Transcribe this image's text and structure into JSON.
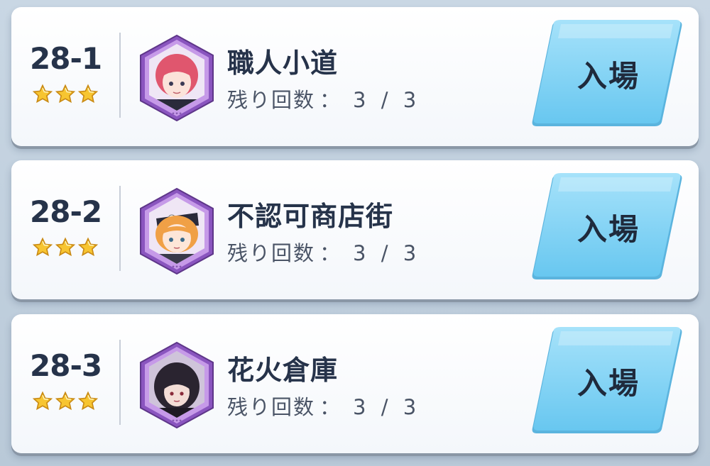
{
  "stages": [
    {
      "id": "28-1",
      "name": "職人小道",
      "stars": 3,
      "attempts_label": "残り回数",
      "attempts_colon": "：",
      "attempts_value": "3 / 3",
      "enter_label": "入場",
      "hair_color": "#e0566e",
      "skin_color": "#fbe3da"
    },
    {
      "id": "28-2",
      "name": "不認可商店街",
      "stars": 3,
      "attempts_label": "残り回数",
      "attempts_colon": "：",
      "attempts_value": "3 / 3",
      "enter_label": "入場",
      "hair_color": "#f0a046",
      "skin_color": "#fde6d8"
    },
    {
      "id": "28-3",
      "name": "花火倉庫",
      "stars": 3,
      "attempts_label": "残り回数",
      "attempts_colon": "：",
      "attempts_value": "3 / 3",
      "enter_label": "入場",
      "hair_color": "#2a2430",
      "skin_color": "#f3ddd6"
    }
  ],
  "colors": {
    "button": "#7fd2f4",
    "portrait_frame": "#a36fd0",
    "star": "#f7c531",
    "text_dark": "#26334a"
  }
}
